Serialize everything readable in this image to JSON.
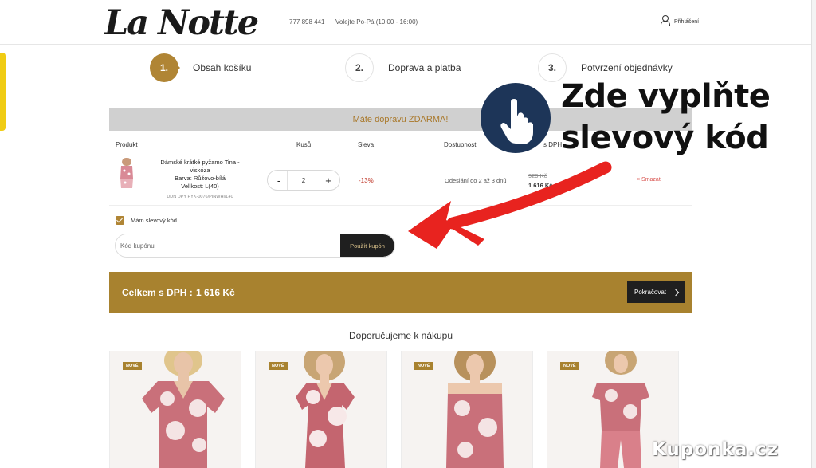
{
  "header": {
    "logo": "La Notte",
    "phone": "777 898 441",
    "hours": "Volejte Po-Pá (10:00 - 16:00)",
    "login": "Přihlášení"
  },
  "steps": [
    {
      "num": "1.",
      "label": "Obsah košíku"
    },
    {
      "num": "2.",
      "label": "Doprava a platba"
    },
    {
      "num": "3.",
      "label": "Potvrzení objednávky"
    }
  ],
  "free_shipping": "Máte dopravu ZDARMA!",
  "table": {
    "headers": {
      "product": "Produkt",
      "qty": "Kusů",
      "discount": "Sleva",
      "availability": "Dostupnost",
      "price": "s DPH"
    },
    "item": {
      "name_line1": "Dámské krátké pyžamo Tina -",
      "name_line2": "viskóza",
      "color": "Barva: Růžovo-bílá",
      "size": "Velikost: L(40)",
      "code": "DDN DPY PYK-0076/PINWHI/L40",
      "qty": "2",
      "qty_minus": "-",
      "qty_plus": "+",
      "discount": "-13%",
      "availability": "Odeslání do 2 až 3 dnů",
      "old_price": "929 Kč",
      "new_price": "1 616 Kč",
      "remove": "× Smazat"
    }
  },
  "coupon": {
    "checkbox_label": "Mám slevový kód",
    "placeholder": "Kód kupónu",
    "apply": "Použít kupón"
  },
  "total": {
    "label": "Celkem s DPH :",
    "value": "1 616 Kč",
    "continue": "Pokračovat"
  },
  "recommend": {
    "title": "Doporučujeme k nákupu",
    "badge": "NOVÉ"
  },
  "annotation": {
    "line1": "Zde vyplňte",
    "line2": "slevový kód"
  },
  "watermark": "Kuponka.cz",
  "colors": {
    "accent": "#a8822f",
    "dark": "#1f1f1f",
    "arrow": "#e8231f",
    "hand_bg": "#1d3558"
  }
}
